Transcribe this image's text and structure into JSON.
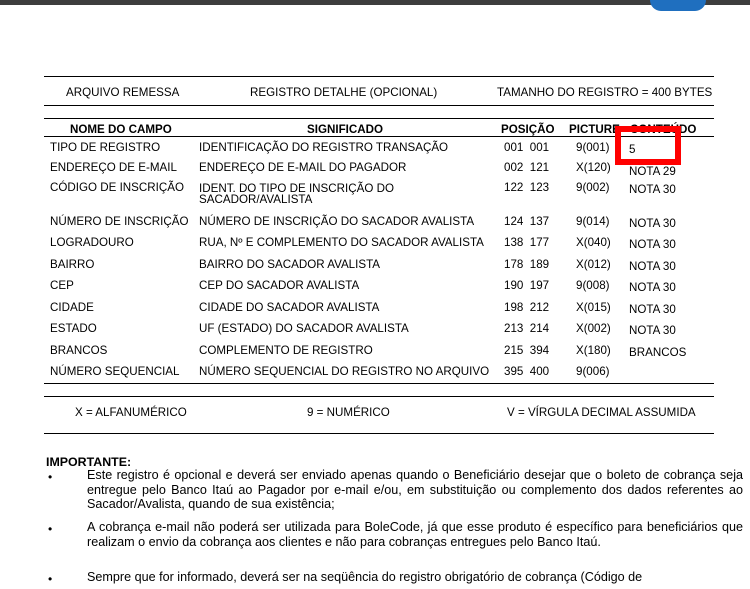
{
  "header": {
    "left": "ARQUIVO REMESSA",
    "center": "REGISTRO DETALHE (OPCIONAL)",
    "right": "TAMANHO DO REGISTRO = 400 BYTES"
  },
  "table": {
    "columns": [
      "NOME DO CAMPO",
      "SIGNIFICADO",
      "POSIÇÃO",
      "PICTURE",
      "CONTEÚDO"
    ],
    "rows": [
      {
        "campo": "TIPO DE REGISTRO",
        "significado": "IDENTIFICAÇÃO DO REGISTRO TRANSAÇÃO",
        "pos": "001  001",
        "picture": "9(001)",
        "conteudo": "5"
      },
      {
        "campo": "ENDEREÇO DE E-MAIL",
        "significado": "ENDEREÇO DE E-MAIL DO PAGADOR",
        "pos": "002  121",
        "picture": "X(120)",
        "conteudo": "NOTA 29"
      },
      {
        "campo": "CÓDIGO DE INSCRIÇÃO",
        "significado": "IDENT. DO TIPO DE INSCRIÇÃO DO SACADOR/AVALISTA",
        "pos": "122  123",
        "picture": "9(002)",
        "conteudo": "NOTA 30"
      },
      {
        "campo": "NÚMERO DE INSCRIÇÃO",
        "significado": "NÚMERO DE INSCRIÇÃO DO SACADOR AVALISTA",
        "pos": "124  137",
        "picture": "9(014)",
        "conteudo": "NOTA 30"
      },
      {
        "campo": "LOGRADOURO",
        "significado": "RUA, Nº E COMPLEMENTO DO SACADOR AVALISTA",
        "pos": "138  177",
        "picture": "X(040)",
        "conteudo": "NOTA 30"
      },
      {
        "campo": "BAIRRO",
        "significado": "BAIRRO DO SACADOR AVALISTA",
        "pos": "178  189",
        "picture": "X(012)",
        "conteudo": "NOTA 30"
      },
      {
        "campo": "CEP",
        "significado": "CEP DO SACADOR AVALISTA",
        "pos": "190  197",
        "picture": "9(008)",
        "conteudo": "NOTA 30"
      },
      {
        "campo": "CIDADE",
        "significado": "CIDADE DO SACADOR AVALISTA",
        "pos": "198  212",
        "picture": "X(015)",
        "conteudo": "NOTA 30"
      },
      {
        "campo": "ESTADO",
        "significado": "UF (ESTADO) DO SACADOR AVALISTA",
        "pos": "213  214",
        "picture": "X(002)",
        "conteudo": "NOTA 30"
      },
      {
        "campo": "BRANCOS",
        "significado": "COMPLEMENTO DE REGISTRO",
        "pos": "215  394",
        "picture": "X(180)",
        "conteudo": "BRANCOS"
      },
      {
        "campo": "NÚMERO SEQUENCIAL",
        "significado": "NÚMERO SEQUENCIAL DO REGISTRO NO ARQUIVO",
        "pos": "395  400",
        "picture": "9(006)",
        "conteudo": ""
      }
    ]
  },
  "legend": {
    "alpha": "X = ALFANUMÉRICO",
    "numeric": "9 = NUMÉRICO",
    "decimal": "V = VÍRGULA DECIMAL ASSUMIDA"
  },
  "important": {
    "title": "IMPORTANTE:",
    "bullets": [
      "Este registro é opcional e deverá ser enviado apenas quando o Beneficiário desejar que o boleto de cobrança seja entregue pelo Banco Itaú ao Pagador por e-mail e/ou, em substituição ou complemento dos dados referentes ao Sacador/Avalista, quando de sua existência;",
      "A cobrança e-mail não poderá ser utilizada para  BoleCode, já que esse produto é específico para beneficiários que realizam o envio da cobrança aos clientes e não para cobranças entregues pelo Banco Itaú.",
      "Sempre que for informado, deverá ser na seqüência do registro obrigatório de cobrança (Código de"
    ],
    "bullet_glyph": "•"
  },
  "colors": {
    "highlight": "#ff0000",
    "topbar": "#3d3d3d",
    "topbar_button": "#1f6fbf"
  }
}
